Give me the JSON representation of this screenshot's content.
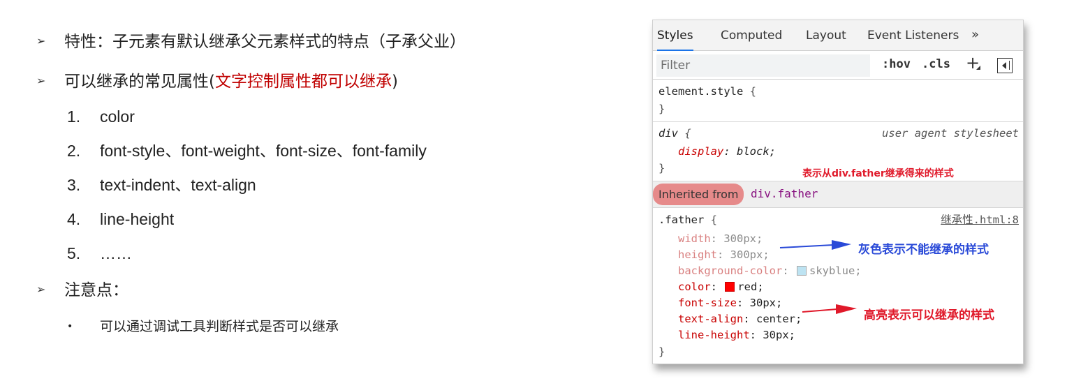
{
  "slide": {
    "arrow_glyph": "➢",
    "bullet_1": "特性：子元素有默认继承父元素样式的特点（子承父业）",
    "bullet_2_prefix": "可以继承的常见属性(",
    "bullet_2_highlight": "文字控制属性都可以继承",
    "bullet_2_suffix": ")",
    "numbered": [
      {
        "num": "1.",
        "text": "color"
      },
      {
        "num": "2.",
        "text": "font-style、font-weight、font-size、font-family"
      },
      {
        "num": "3.",
        "text": "text-indent、text-align"
      },
      {
        "num": "4.",
        "text": "line-height"
      },
      {
        "num": "5.",
        "text": "……"
      }
    ],
    "bullet_3": "注意点：",
    "sub_dot": "•",
    "sub_bullet": "可以通过调试工具判断样式是否可以继承",
    "highlight_color": "#c00000"
  },
  "devtools": {
    "tabs": [
      "Styles",
      "Computed",
      "Layout",
      "Event Listeners"
    ],
    "active_tab": "Styles",
    "more_tabs": "»",
    "filter_placeholder": "Filter",
    "hov": ":hov",
    "cls": ".cls",
    "plus": "+",
    "element_style": {
      "selector": "element.style",
      "open": "{",
      "close": "}"
    },
    "div_rule": {
      "selector": "div",
      "open": "{",
      "source": "user agent stylesheet",
      "prop": "display",
      "value": "block;",
      "close": "}"
    },
    "inherited": {
      "label": "Inherited from",
      "target": "div.father"
    },
    "father_rule": {
      "selector": ".father",
      "open": "{",
      "source": "继承性.html:8",
      "close": "}",
      "declarations": [
        {
          "prop": "width",
          "value": "300px;",
          "dimmed": true
        },
        {
          "prop": "height",
          "value": "300px;",
          "dimmed": true
        },
        {
          "prop": "background-color",
          "value": "skyblue;",
          "dimmed": true,
          "swatch": "#bde3f2"
        },
        {
          "prop": "color",
          "value": "red;",
          "dimmed": false,
          "swatch": "#ff0000"
        },
        {
          "prop": "font-size",
          "value": "30px;",
          "dimmed": false
        },
        {
          "prop": "text-align",
          "value": "center;",
          "dimmed": false
        },
        {
          "prop": "line-height",
          "value": "30px;",
          "dimmed": false
        }
      ]
    },
    "annotations": {
      "inherited_note": "表示从div.father继承得来的样式",
      "gray_note": "灰色表示不能继承的样式",
      "highlight_note": "高亮表示可以继承的样式",
      "blue_color": "#2a4ad8",
      "red_color": "#e0192a"
    }
  }
}
